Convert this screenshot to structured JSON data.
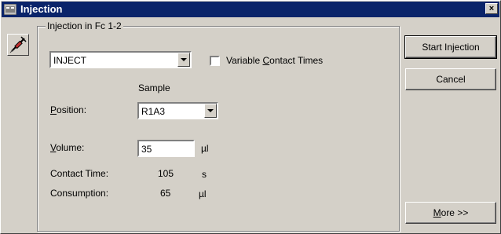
{
  "window": {
    "title": "Injection",
    "close_glyph": "×"
  },
  "group": {
    "label": "Injection in Fc 1-2"
  },
  "type_combo": {
    "value": "INJECT"
  },
  "variable_contact": {
    "label_pre": "Variable ",
    "label_accel": "C",
    "label_post": "ontact Times",
    "checked": false
  },
  "sample_header": "Sample",
  "position": {
    "label_accel": "P",
    "label_post": "osition:",
    "value": "R1A3"
  },
  "volume": {
    "label_accel": "V",
    "label_post": "olume:",
    "value": "35",
    "unit": "µl"
  },
  "contact_time": {
    "label": "Contact Time:",
    "value": "105",
    "unit": "s"
  },
  "consumption": {
    "label": "Consumption:",
    "value": "65",
    "unit": "µl"
  },
  "buttons": {
    "start": "Start Injection",
    "cancel": "Cancel",
    "more_accel": "M",
    "more_post": "ore >>"
  },
  "icons": {
    "window": "window-icon",
    "tool": "syringe-icon"
  }
}
